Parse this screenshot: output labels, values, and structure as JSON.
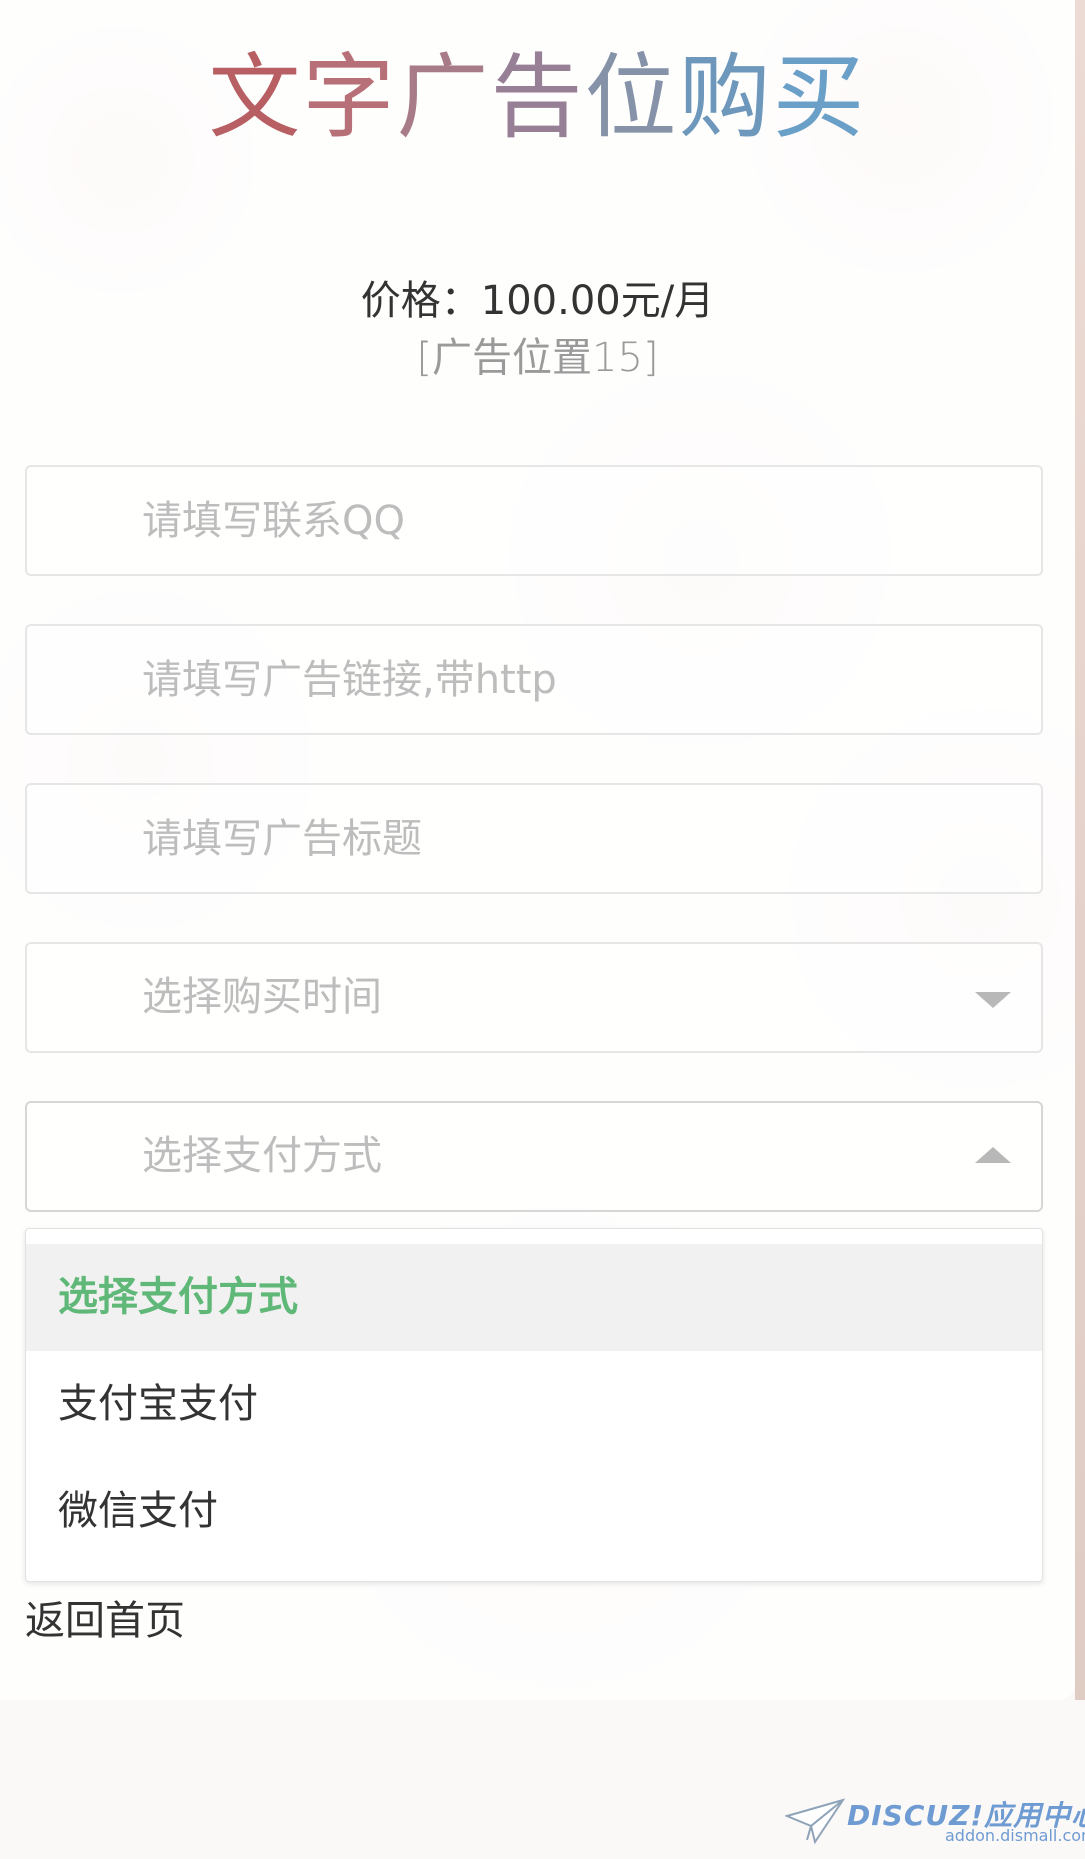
{
  "title": {
    "chars": [
      "文",
      "字",
      "广",
      "告",
      "位",
      "购",
      "买"
    ],
    "colors": [
      "#b85f63",
      "#b87078",
      "#a77b88",
      "#977f95",
      "#8592a8",
      "#6e98bb",
      "#6aa0c8"
    ]
  },
  "price_line": "价格：100.00元/月",
  "slot_line": "[广告位置15]",
  "form": {
    "qq_placeholder": "请填写联系QQ",
    "link_placeholder": "请填写广告链接,带http",
    "title_placeholder": "请填写广告标题",
    "time_select_text": "选择购买时间",
    "payment_select_text": "选择支付方式"
  },
  "payment_dropdown": {
    "options": [
      "选择支付方式",
      "支付宝支付",
      "微信支付"
    ],
    "selected_index": 0,
    "selected_color": "#5fb878"
  },
  "back_link": "返回首页",
  "watermark": {
    "brand": "DISCUZ!应用中心",
    "url": "addon.dismall.com"
  }
}
